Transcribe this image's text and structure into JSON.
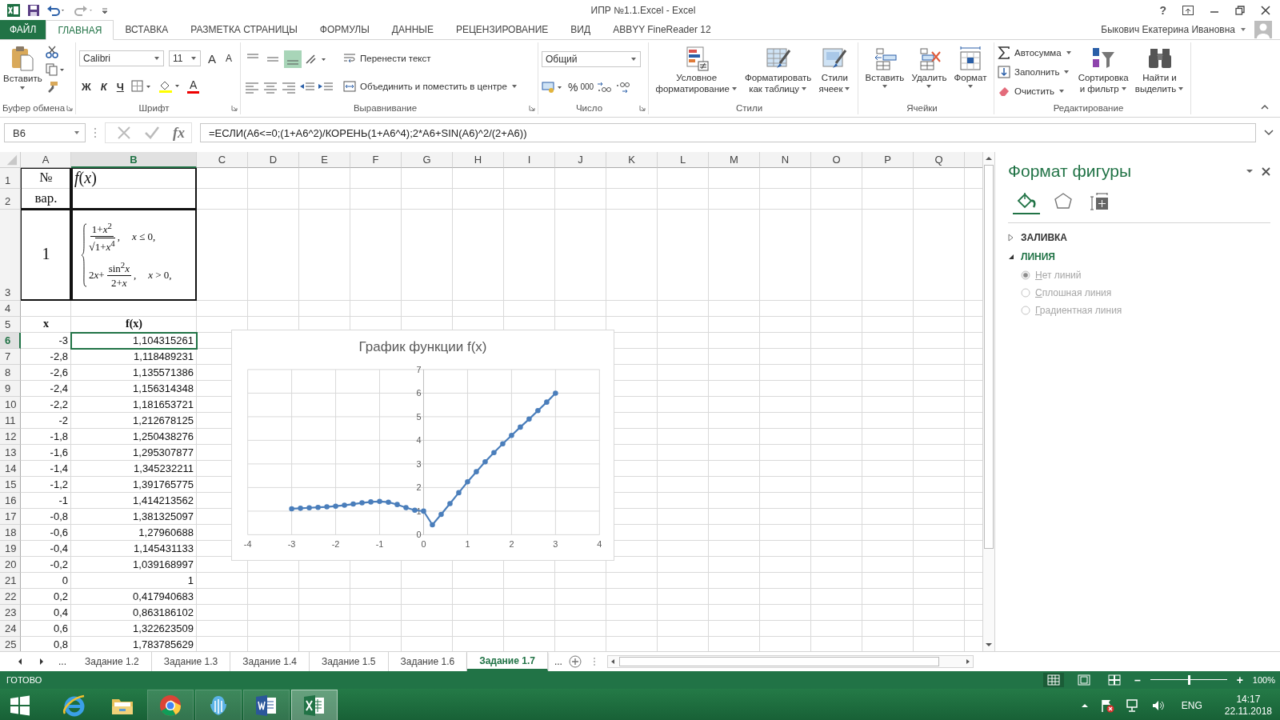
{
  "window": {
    "title": "ИПР №1.1.Excel - Excel",
    "help": "?"
  },
  "tabs": [
    {
      "label": "ФАЙЛ",
      "kind": "file",
      "selected": false
    },
    {
      "label": "ГЛАВНАЯ",
      "kind": "tab",
      "selected": true
    },
    {
      "label": "ВСТАВКА",
      "kind": "tab",
      "selected": false
    },
    {
      "label": "РАЗМЕТКА СТРАНИЦЫ",
      "kind": "tab",
      "selected": false
    },
    {
      "label": "ФОРМУЛЫ",
      "kind": "tab",
      "selected": false
    },
    {
      "label": "ДАННЫЕ",
      "kind": "tab",
      "selected": false
    },
    {
      "label": "РЕЦЕНЗИРОВАНИЕ",
      "kind": "tab",
      "selected": false
    },
    {
      "label": "ВИД",
      "kind": "tab",
      "selected": false
    },
    {
      "label": "ABBYY FineReader 12",
      "kind": "tab",
      "selected": false
    }
  ],
  "user": {
    "name": "Быкович Екатерина Ивановна"
  },
  "ribbon": {
    "clipboard": {
      "paste": "Вставить",
      "label": "Буфер обмена"
    },
    "font": {
      "name": "Calibri",
      "size": "11",
      "grow": "A",
      "shrink": "A",
      "bold": "Ж",
      "italic": "К",
      "underline": "Ч",
      "tint_letter": "A",
      "label": "Шрифт"
    },
    "alignment": {
      "vertical": [
        {
          "selected": false
        },
        {
          "selected": false
        },
        {
          "selected": true
        }
      ],
      "wrap": "Перенести текст",
      "merge": "Объединить и поместить в центре",
      "label": "Выравнивание"
    },
    "number": {
      "format": "Общий",
      "percent": "%",
      "thousands": "000",
      "label": "Число"
    },
    "styles": {
      "buttons": [
        {
          "kind": "conditional",
          "lines": [
            "Условное",
            "форматирование"
          ]
        },
        {
          "kind": "table",
          "lines": [
            "Форматировать",
            "как таблицу"
          ]
        },
        {
          "kind": "cellstyles",
          "lines": [
            "Стили",
            "ячеек"
          ]
        }
      ],
      "label": "Стили"
    },
    "cells": {
      "buttons": [
        {
          "kind": "insert",
          "label": "Вставить"
        },
        {
          "kind": "delete",
          "label": "Удалить"
        },
        {
          "kind": "format",
          "label": "Формат"
        }
      ],
      "label": "Ячейки"
    },
    "editing": {
      "autosum": "Автосумма",
      "fill": "Заполнить",
      "clear": "Очистить",
      "sort": [
        "Сортировка",
        "и фильтр"
      ],
      "find": [
        "Найти и",
        "выделить"
      ],
      "label": "Редактирование"
    }
  },
  "formula_bar": {
    "name_box": "B6",
    "fx": "fx",
    "formula": "=ЕСЛИ(A6<=0;(1+A6^2)/КОРЕНЬ(1+A6^4);2*A6+SIN(A6)^2/(2+A6))"
  },
  "sheet": {
    "columns": [
      {
        "label": "A",
        "selected": false
      },
      {
        "label": "B",
        "selected": true
      },
      {
        "label": "C",
        "selected": false
      },
      {
        "label": "D",
        "selected": false
      },
      {
        "label": "E",
        "selected": false
      },
      {
        "label": "F",
        "selected": false
      },
      {
        "label": "G",
        "selected": false
      },
      {
        "label": "H",
        "selected": false
      },
      {
        "label": "I",
        "selected": false
      },
      {
        "label": "J",
        "selected": false
      },
      {
        "label": "K",
        "selected": false
      },
      {
        "label": "L",
        "selected": false
      },
      {
        "label": "M",
        "selected": false
      },
      {
        "label": "N",
        "selected": false
      },
      {
        "label": "O",
        "selected": false
      },
      {
        "label": "P",
        "selected": false
      },
      {
        "label": "Q",
        "selected": false
      }
    ],
    "equation": {
      "cases": [
        {
          "numerator": "1+*x*$^{2}$",
          "root": "√",
          "denominator": "1+*x*$^{4}$",
          "suffix": ",",
          "condition": "*x* ≤ 0,"
        },
        {
          "coefficient": "2",
          "variable": "x",
          "operator": "+",
          "numerator": "sin$^{2}$*x*",
          "denominator": "2+*x*",
          "suffix": ",",
          "condition": "*x* > 0,"
        }
      ]
    },
    "rows": [
      {
        "label": "1",
        "kind": "title",
        "selected": false,
        "a": "№",
        "b": "*f*(*x*)"
      },
      {
        "label": "2",
        "kind": "title",
        "selected": false,
        "a": "вар."
      },
      {
        "label": "3",
        "kind": "equation",
        "selected": false,
        "a": "1"
      },
      {
        "label": "4",
        "kind": "blank",
        "selected": false
      },
      {
        "label": "5",
        "kind": "header",
        "selected": false,
        "a": "x",
        "b": "f(x)"
      },
      {
        "label": "6",
        "kind": "data",
        "selected": true,
        "a": "-3",
        "b": "1,104315261"
      },
      {
        "label": "7",
        "kind": "data",
        "selected": false,
        "a": "-2,8",
        "b": "1,118489231"
      },
      {
        "label": "8",
        "kind": "data",
        "selected": false,
        "a": "-2,6",
        "b": "1,135571386"
      },
      {
        "label": "9",
        "kind": "data",
        "selected": false,
        "a": "-2,4",
        "b": "1,156314348"
      },
      {
        "label": "10",
        "kind": "data",
        "selected": false,
        "a": "-2,2",
        "b": "1,181653721"
      },
      {
        "label": "11",
        "kind": "data",
        "selected": false,
        "a": "-2",
        "b": "1,212678125"
      },
      {
        "label": "12",
        "kind": "data",
        "selected": false,
        "a": "-1,8",
        "b": "1,250438276"
      },
      {
        "label": "13",
        "kind": "data",
        "selected": false,
        "a": "-1,6",
        "b": "1,295307877"
      },
      {
        "label": "14",
        "kind": "data",
        "selected": false,
        "a": "-1,4",
        "b": "1,345232211"
      },
      {
        "label": "15",
        "kind": "data",
        "selected": false,
        "a": "-1,2",
        "b": "1,391765775"
      },
      {
        "label": "16",
        "kind": "data",
        "selected": false,
        "a": "-1",
        "b": "1,414213562"
      },
      {
        "label": "17",
        "kind": "data",
        "selected": false,
        "a": "-0,8",
        "b": "1,381325097"
      },
      {
        "label": "18",
        "kind": "data",
        "selected": false,
        "a": "-0,6",
        "b": "1,27960688"
      },
      {
        "label": "19",
        "kind": "data",
        "selected": false,
        "a": "-0,4",
        "b": "1,145431133"
      },
      {
        "label": "20",
        "kind": "data",
        "selected": false,
        "a": "-0,2",
        "b": "1,039168997"
      },
      {
        "label": "21",
        "kind": "data",
        "selected": false,
        "a": "0",
        "b": "1"
      },
      {
        "label": "22",
        "kind": "data",
        "selected": false,
        "a": "0,2",
        "b": "0,417940683"
      },
      {
        "label": "23",
        "kind": "data",
        "selected": false,
        "a": "0,4",
        "b": "0,863186102"
      },
      {
        "label": "24",
        "kind": "data",
        "selected": false,
        "a": "0,6",
        "b": "1,322623509"
      },
      {
        "label": "25",
        "kind": "data",
        "selected": false,
        "a": "0,8",
        "b": "1,783785629"
      }
    ]
  },
  "chart": {
    "chart_data": {
      "type": "line",
      "title": "График функции f(x)",
      "grid": true,
      "marker": "circle",
      "x": [
        -3,
        -2.8,
        -2.6,
        -2.4,
        -2.2,
        -2,
        -1.8,
        -1.6,
        -1.4,
        -1.2,
        -1,
        -0.8,
        -0.6,
        -0.4,
        -0.2,
        0,
        0.2,
        0.4,
        0.6,
        0.8,
        1,
        1.2,
        1.4,
        1.6,
        1.8,
        2,
        2.2,
        2.4,
        2.6,
        2.8,
        3
      ],
      "values": [
        1.1,
        1.12,
        1.14,
        1.16,
        1.18,
        1.21,
        1.25,
        1.3,
        1.35,
        1.39,
        1.41,
        1.38,
        1.28,
        1.15,
        1.04,
        1,
        0.42,
        0.86,
        1.32,
        1.78,
        2.24,
        2.67,
        3.09,
        3.48,
        3.85,
        4.21,
        4.56,
        4.9,
        5.26,
        5.62,
        6
      ],
      "xlim": [
        -4,
        4
      ],
      "ylim": [
        0,
        7
      ],
      "xticks": [
        {
          "value": -4,
          "label": "-4"
        },
        {
          "value": -3,
          "label": "-3"
        },
        {
          "value": -2,
          "label": "-2"
        },
        {
          "value": -1,
          "label": "-1"
        },
        {
          "value": 0,
          "label": "0"
        },
        {
          "value": 1,
          "label": "1"
        },
        {
          "value": 2,
          "label": "2"
        },
        {
          "value": 3,
          "label": "3"
        },
        {
          "value": 4,
          "label": "4"
        }
      ],
      "yticks": [
        {
          "value": 0,
          "label": "0"
        },
        {
          "value": 1,
          "label": "1"
        },
        {
          "value": 2,
          "label": "2"
        },
        {
          "value": 3,
          "label": "3"
        },
        {
          "value": 4,
          "label": "4"
        },
        {
          "value": 5,
          "label": "5"
        },
        {
          "value": 6,
          "label": "6"
        },
        {
          "value": 7,
          "label": "7"
        }
      ]
    }
  },
  "panel": {
    "title": "Формат фигуры",
    "icon_tabs": [
      {
        "kind": "fill",
        "selected": true
      },
      {
        "kind": "shape",
        "selected": false
      },
      {
        "kind": "size",
        "selected": false
      }
    ],
    "sections": [
      {
        "label": "ЗАЛИВКА",
        "expanded": false
      },
      {
        "label": "ЛИНИЯ",
        "expanded": true,
        "options": [
          {
            "label": "Нет линий",
            "selected": true,
            "disabled": true
          },
          {
            "label": "Сплошная линия",
            "selected": false,
            "disabled": true
          },
          {
            "label": "Градиентная линия",
            "selected": false,
            "disabled": true
          }
        ]
      }
    ]
  },
  "sheet_tabs": {
    "more_left": "...",
    "more_right": "...",
    "tabs": [
      {
        "label": "Задание 1.2",
        "selected": false
      },
      {
        "label": "Задание 1.3",
        "selected": false
      },
      {
        "label": "Задание 1.4",
        "selected": false
      },
      {
        "label": "Задание 1.5",
        "selected": false
      },
      {
        "label": "Задание 1.6",
        "selected": false
      },
      {
        "label": "Задание 1.7",
        "selected": true
      }
    ]
  },
  "status_bar": {
    "ready": "ГОТОВО",
    "views": [
      {
        "kind": "normal",
        "selected": true
      },
      {
        "kind": "layout",
        "selected": false
      },
      {
        "kind": "pagebreak",
        "selected": false
      }
    ],
    "zoom_out": "–",
    "zoom_in": "+",
    "zoom": {
      "level": 0.5,
      "reading": "100%"
    }
  },
  "taskbar": {
    "apps": [
      {
        "kind": "ie",
        "selected": false
      },
      {
        "kind": "explorer",
        "selected": false
      },
      {
        "kind": "chrome",
        "selected": false
      },
      {
        "kind": "app",
        "selected": false
      },
      {
        "kind": "word",
        "selected": false
      },
      {
        "kind": "excel",
        "selected": true
      }
    ],
    "lang": "ENG",
    "time": "14:17",
    "date": "22.11.2018"
  }
}
